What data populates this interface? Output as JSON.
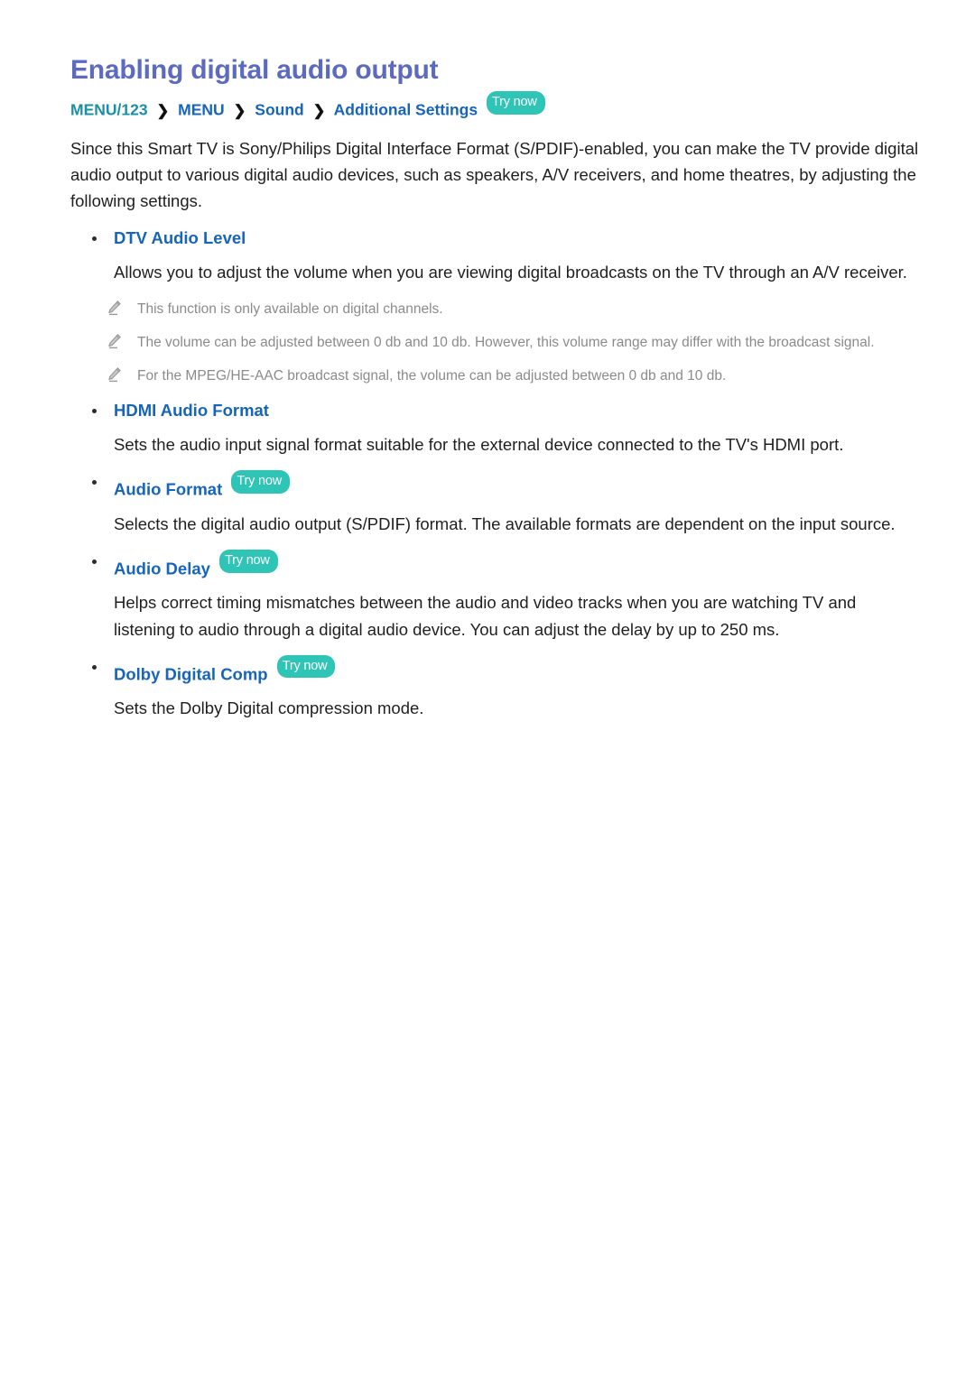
{
  "document": {
    "title": "Enabling digital audio output",
    "breadcrumb": {
      "items": [
        "MENU/123",
        "MENU",
        "Sound",
        "Additional Settings"
      ],
      "separator": "❯",
      "try_now_label": "Try now"
    },
    "intro": "Since this Smart TV is Sony/Philips Digital Interface Format (S/PDIF)-enabled, you can make the TV provide digital audio output to various digital audio devices, such as speakers, A/V receivers, and home theatres, by adjusting the following settings.",
    "sections": [
      {
        "heading": "DTV Audio Level",
        "try_now": "",
        "body": "Allows you to adjust the volume when you are viewing digital broadcasts on the TV through an A/V receiver.",
        "notes": [
          "This function is only available on digital channels.",
          "The volume can be adjusted between 0 db and 10 db. However, this volume range may differ with the broadcast signal.",
          "For the MPEG/HE-AAC broadcast signal, the volume can be adjusted between 0 db and 10 db."
        ]
      },
      {
        "heading": "HDMI Audio Format",
        "try_now": "",
        "body": "Sets the audio input signal format suitable for the external device connected to the TV's HDMI port.",
        "notes": []
      },
      {
        "heading": "Audio Format",
        "try_now": "Try now",
        "body": "Selects the digital audio output (S/PDIF) format. The available formats are dependent on the input source.",
        "notes": []
      },
      {
        "heading": "Audio Delay",
        "try_now": "Try now",
        "body": "Helps correct timing mismatches between the audio and video tracks when you are watching TV and listening to audio through a digital audio device. You can adjust the delay by up to 250 ms.",
        "notes": []
      },
      {
        "heading": "Dolby Digital Comp",
        "try_now": "Try now",
        "body": "Sets the Dolby Digital compression mode.",
        "notes": []
      }
    ],
    "colors": {
      "title": "#5c6bc0",
      "breadcrumb_first": "#1a8fa6",
      "breadcrumb_link": "#1665b8",
      "heading_link": "#1665b8",
      "try_now_badge": "#2ec4b6",
      "body_text": "#1f1f1f",
      "note_text": "#8b8b8b",
      "page_background": "#ffffff"
    },
    "icons": {
      "note": "pencil-icon"
    }
  }
}
